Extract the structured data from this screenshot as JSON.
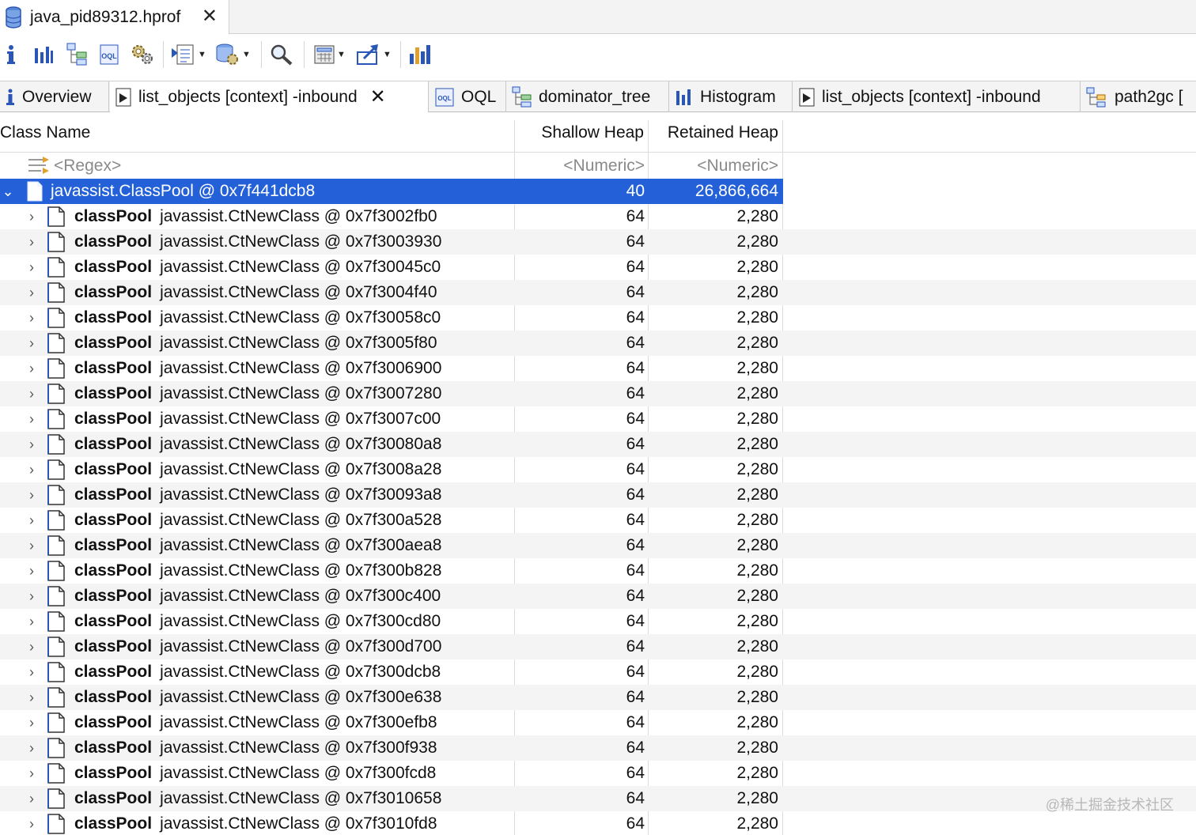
{
  "editor_tab": {
    "title": "java_pid89312.hprof",
    "close": "✕"
  },
  "toolbar": {
    "buttons": [
      {
        "name": "info-icon"
      },
      {
        "name": "histogram-icon"
      },
      {
        "name": "dominator-tree-icon"
      },
      {
        "name": "oql-icon",
        "text": "OQL"
      },
      {
        "name": "thread-overview-icon"
      },
      {
        "name": "run-expert-system-icon",
        "dropdown": true
      },
      {
        "name": "query-browser-icon",
        "dropdown": true
      },
      {
        "name": "search-icon"
      },
      {
        "name": "calculator-icon",
        "dropdown": true
      },
      {
        "name": "export-icon",
        "dropdown": true
      },
      {
        "name": "group-by-icon"
      }
    ]
  },
  "view_tabs": [
    {
      "label": "Overview",
      "icon": "info-icon"
    },
    {
      "label": "list_objects  [context] -inbound",
      "icon": "list-objects-icon",
      "active": true,
      "close": "✕"
    },
    {
      "label": "OQL",
      "icon": "oql-icon"
    },
    {
      "label": "dominator_tree",
      "icon": "dominator-tree-icon"
    },
    {
      "label": "Histogram",
      "icon": "histogram-icon"
    },
    {
      "label": "list_objects  [context] -inbound",
      "icon": "list-objects-icon"
    },
    {
      "label": "path2gc  [",
      "icon": "path2gc-icon"
    }
  ],
  "table": {
    "columns": [
      "Class Name",
      "Shallow Heap",
      "Retained Heap"
    ],
    "filter_row": {
      "name": "<Regex>",
      "shallow": "<Numeric>",
      "retained": "<Numeric>"
    },
    "root": {
      "name": "javassist.ClassPool @ 0x7f441dcb8",
      "shallow": "40",
      "retained": "26,866,664"
    },
    "children": [
      {
        "field": "classPool",
        "name": "javassist.CtNewClass @ 0x7f3002fb0",
        "shallow": "64",
        "retained": "2,280"
      },
      {
        "field": "classPool",
        "name": "javassist.CtNewClass @ 0x7f3003930",
        "shallow": "64",
        "retained": "2,280"
      },
      {
        "field": "classPool",
        "name": "javassist.CtNewClass @ 0x7f30045c0",
        "shallow": "64",
        "retained": "2,280"
      },
      {
        "field": "classPool",
        "name": "javassist.CtNewClass @ 0x7f3004f40",
        "shallow": "64",
        "retained": "2,280"
      },
      {
        "field": "classPool",
        "name": "javassist.CtNewClass @ 0x7f30058c0",
        "shallow": "64",
        "retained": "2,280"
      },
      {
        "field": "classPool",
        "name": "javassist.CtNewClass @ 0x7f3005f80",
        "shallow": "64",
        "retained": "2,280"
      },
      {
        "field": "classPool",
        "name": "javassist.CtNewClass @ 0x7f3006900",
        "shallow": "64",
        "retained": "2,280"
      },
      {
        "field": "classPool",
        "name": "javassist.CtNewClass @ 0x7f3007280",
        "shallow": "64",
        "retained": "2,280"
      },
      {
        "field": "classPool",
        "name": "javassist.CtNewClass @ 0x7f3007c00",
        "shallow": "64",
        "retained": "2,280"
      },
      {
        "field": "classPool",
        "name": "javassist.CtNewClass @ 0x7f30080a8",
        "shallow": "64",
        "retained": "2,280"
      },
      {
        "field": "classPool",
        "name": "javassist.CtNewClass @ 0x7f3008a28",
        "shallow": "64",
        "retained": "2,280"
      },
      {
        "field": "classPool",
        "name": "javassist.CtNewClass @ 0x7f30093a8",
        "shallow": "64",
        "retained": "2,280"
      },
      {
        "field": "classPool",
        "name": "javassist.CtNewClass @ 0x7f300a528",
        "shallow": "64",
        "retained": "2,280"
      },
      {
        "field": "classPool",
        "name": "javassist.CtNewClass @ 0x7f300aea8",
        "shallow": "64",
        "retained": "2,280"
      },
      {
        "field": "classPool",
        "name": "javassist.CtNewClass @ 0x7f300b828",
        "shallow": "64",
        "retained": "2,280"
      },
      {
        "field": "classPool",
        "name": "javassist.CtNewClass @ 0x7f300c400",
        "shallow": "64",
        "retained": "2,280"
      },
      {
        "field": "classPool",
        "name": "javassist.CtNewClass @ 0x7f300cd80",
        "shallow": "64",
        "retained": "2,280"
      },
      {
        "field": "classPool",
        "name": "javassist.CtNewClass @ 0x7f300d700",
        "shallow": "64",
        "retained": "2,280"
      },
      {
        "field": "classPool",
        "name": "javassist.CtNewClass @ 0x7f300dcb8",
        "shallow": "64",
        "retained": "2,280"
      },
      {
        "field": "classPool",
        "name": "javassist.CtNewClass @ 0x7f300e638",
        "shallow": "64",
        "retained": "2,280"
      },
      {
        "field": "classPool",
        "name": "javassist.CtNewClass @ 0x7f300efb8",
        "shallow": "64",
        "retained": "2,280"
      },
      {
        "field": "classPool",
        "name": "javassist.CtNewClass @ 0x7f300f938",
        "shallow": "64",
        "retained": "2,280"
      },
      {
        "field": "classPool",
        "name": "javassist.CtNewClass @ 0x7f300fcd8",
        "shallow": "64",
        "retained": "2,280"
      },
      {
        "field": "classPool",
        "name": "javassist.CtNewClass @ 0x7f3010658",
        "shallow": "64",
        "retained": "2,280"
      },
      {
        "field": "classPool",
        "name": "javassist.CtNewClass @ 0x7f3010fd8",
        "shallow": "64",
        "retained": "2,280"
      }
    ]
  },
  "watermark": "@稀土掘金技术社区",
  "colors": {
    "selection": "#2461d9",
    "alt_row": "#f4f4f4",
    "icon_blue": "#2a56b8"
  }
}
